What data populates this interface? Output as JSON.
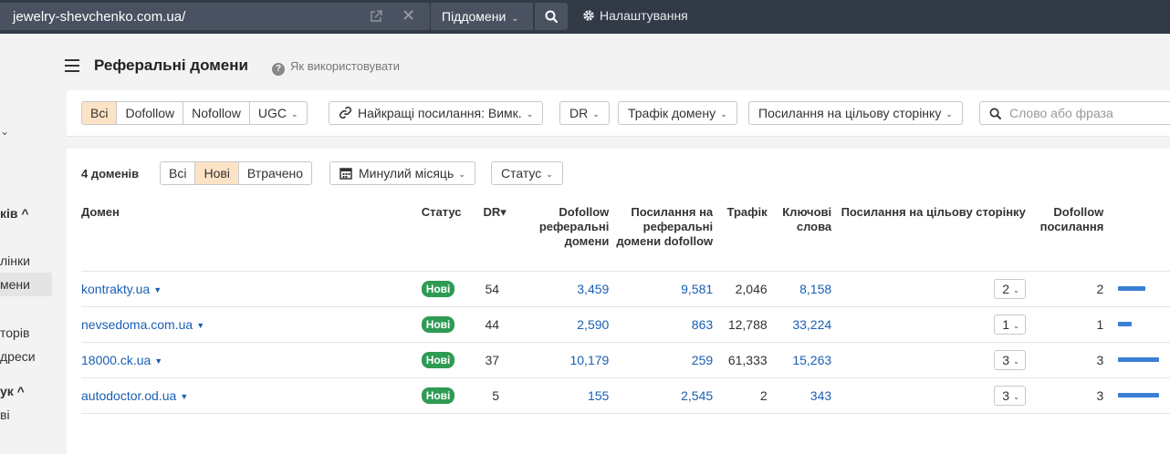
{
  "topbar": {
    "url": "jewelry-shevchenko.com.ua/",
    "subdomains_label": "Піддомени",
    "settings_label": "Налаштування"
  },
  "sidebar": {
    "items": [
      {
        "label": "ків ^",
        "bold": true
      },
      {
        "label": "лінки"
      },
      {
        "label": "мени",
        "active": true
      },
      {
        "label": "торів"
      },
      {
        "label": "дреси"
      },
      {
        "label": "ук ^",
        "bold": true
      },
      {
        "label": "ві"
      }
    ]
  },
  "header": {
    "title": "Реферальні домени",
    "help": "Як використовувати"
  },
  "filters": {
    "type_tabs": [
      "Всі",
      "Dofollow",
      "Nofollow",
      "UGC"
    ],
    "best_links": "Найкращі посилання: Вимк.",
    "dr": "DR",
    "traffic": "Трафік домену",
    "target_links": "Посилання на цільову сторінку",
    "search_placeholder": "Слово або фраза"
  },
  "card": {
    "count": "4 доменів",
    "state_tabs": [
      "Всі",
      "Нові",
      "Втрачено"
    ],
    "period": "Минулий місяць",
    "status": "Статус"
  },
  "table": {
    "headers": {
      "domain": "Домен",
      "status": "Статус",
      "dr": "DR▾",
      "dofollow_ref": "Dofollow реферальні домени",
      "links_ref": "Посилання на реферальні домени dofollow",
      "traffic": "Трафік",
      "keywords": "Ключові слова",
      "target_links": "Посилання на цільову сторінку",
      "dofollow_links": "Dofollow посилання"
    },
    "rows": [
      {
        "domain": "kontrakty.ua",
        "status": "Нові",
        "dr": "54",
        "dofollow_ref": "3,459",
        "links_ref": "9,581",
        "traffic": "2,046",
        "keywords": "8,158",
        "target": "2",
        "dofollow_links": "2",
        "bar": 0.67
      },
      {
        "domain": "nevsedoma.com.ua",
        "status": "Нові",
        "dr": "44",
        "dofollow_ref": "2,590",
        "links_ref": "863",
        "traffic": "12,788",
        "keywords": "33,224",
        "target": "1",
        "dofollow_links": "1",
        "bar": 0.33
      },
      {
        "domain": "18000.ck.ua",
        "status": "Нові",
        "dr": "37",
        "dofollow_ref": "10,179",
        "links_ref": "259",
        "traffic": "61,333",
        "keywords": "15,263",
        "target": "3",
        "dofollow_links": "3",
        "bar": 1.0
      },
      {
        "domain": "autodoctor.od.ua",
        "status": "Нові",
        "dr": "5",
        "dofollow_ref": "155",
        "links_ref": "2,545",
        "traffic": "2",
        "keywords": "343",
        "target": "3",
        "dofollow_links": "3",
        "bar": 1.0
      }
    ]
  }
}
